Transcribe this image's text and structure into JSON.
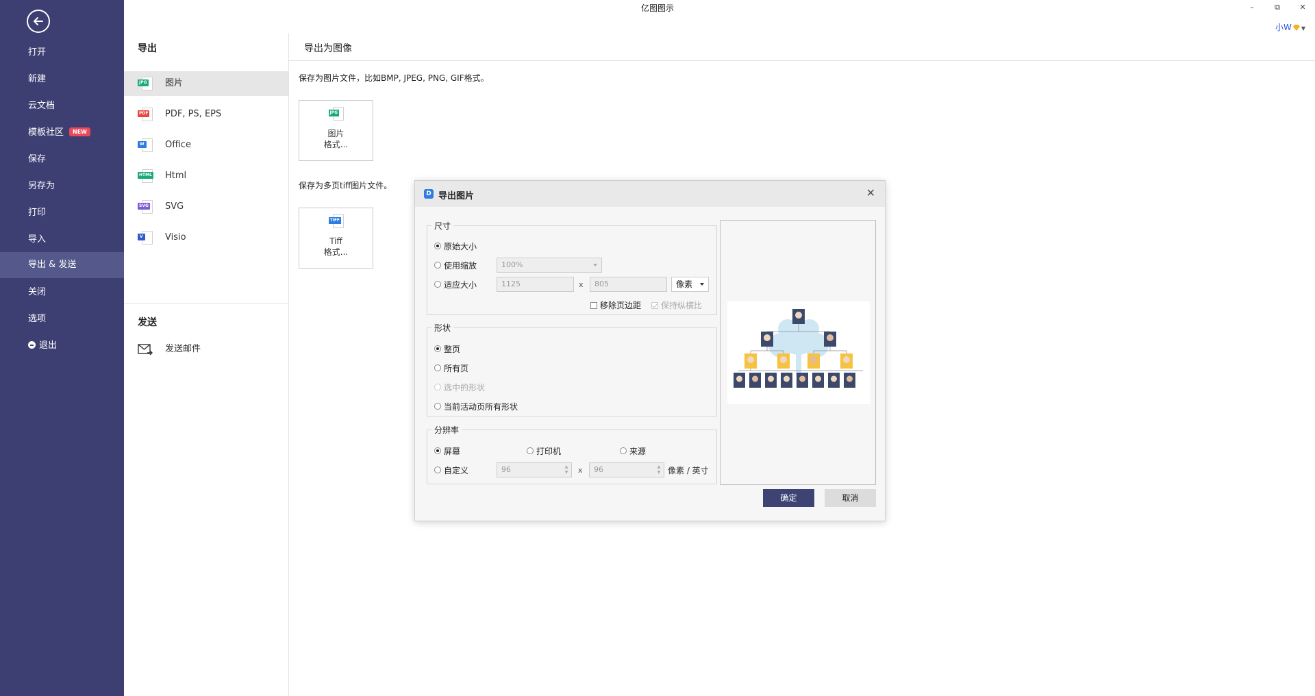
{
  "app": {
    "title": "亿图图示",
    "user": "小W"
  },
  "window_controls": {
    "minimize": "–",
    "restore": "⧉",
    "close": "✕"
  },
  "leftnav": {
    "items": [
      {
        "label": "打开"
      },
      {
        "label": "新建"
      },
      {
        "label": "云文档"
      },
      {
        "label": "模板社区",
        "badge": "NEW"
      },
      {
        "label": "保存"
      },
      {
        "label": "另存为"
      },
      {
        "label": "打印"
      },
      {
        "label": "导入"
      },
      {
        "label": "导出 & 发送",
        "active": true
      },
      {
        "label": "关闭"
      },
      {
        "label": "选项"
      },
      {
        "label": "退出"
      }
    ]
  },
  "export_section": {
    "title": "导出",
    "items": [
      {
        "label": "图片",
        "icon": "jpg-icon",
        "tag": "JPG",
        "color": "#1aaa78"
      },
      {
        "label": "PDF, PS, EPS",
        "icon": "pdf-icon",
        "tag": "PDF",
        "color": "#e8473d"
      },
      {
        "label": "Office",
        "icon": "word-icon",
        "tag": "W",
        "color": "#2f7de1"
      },
      {
        "label": "Html",
        "icon": "html-icon",
        "tag": "HTML",
        "color": "#1aaa78"
      },
      {
        "label": "SVG",
        "icon": "svg-icon",
        "tag": "SVG",
        "color": "#7c5cd6"
      },
      {
        "label": "Visio",
        "icon": "visio-icon",
        "tag": "V",
        "color": "#2f5cc9"
      }
    ]
  },
  "send_section": {
    "title": "发送",
    "items": [
      {
        "label": "发送邮件",
        "icon": "mail-icon"
      }
    ]
  },
  "panel": {
    "title": "导出为图像",
    "desc1": "保存为图片文件，比如BMP, JPEG, PNG, GIF格式。",
    "card1": {
      "line1": "图片",
      "line2": "格式...",
      "tag": "JPG"
    },
    "desc2": "保存为多页tiff图片文件。",
    "card2": {
      "line1": "Tiff",
      "line2": "格式...",
      "tag": "TIFF"
    }
  },
  "dialog": {
    "title": "导出图片",
    "size_group": {
      "legend": "尺寸",
      "original": "原始大小",
      "zoom": "使用缩放",
      "zoom_value": "100%",
      "fit": "适应大小",
      "width": "1125",
      "x": "x",
      "height": "805",
      "unit": "像素",
      "remove_margin": "移除页边距",
      "keep_ratio": "保持纵横比"
    },
    "shape_group": {
      "legend": "形状",
      "whole_page": "整页",
      "all_pages": "所有页",
      "selected": "选中的形状",
      "current_page_all": "当前活动页所有形状"
    },
    "resolution_group": {
      "legend": "分辨率",
      "screen": "屏幕",
      "printer": "打印机",
      "source": "来源",
      "custom": "自定义",
      "dpi_x": "96",
      "x": "x",
      "dpi_y": "96",
      "unit": "像素 / 英寸"
    },
    "ok": "确定",
    "cancel": "取消"
  },
  "colors": {
    "sidebar_bg": "#3d3f72",
    "sidebar_active": "#55588a",
    "primary_button": "#3d4373",
    "new_badge": "#e9485a",
    "org_highlight": "#f5c242",
    "org_node": "#3b4a6b"
  }
}
